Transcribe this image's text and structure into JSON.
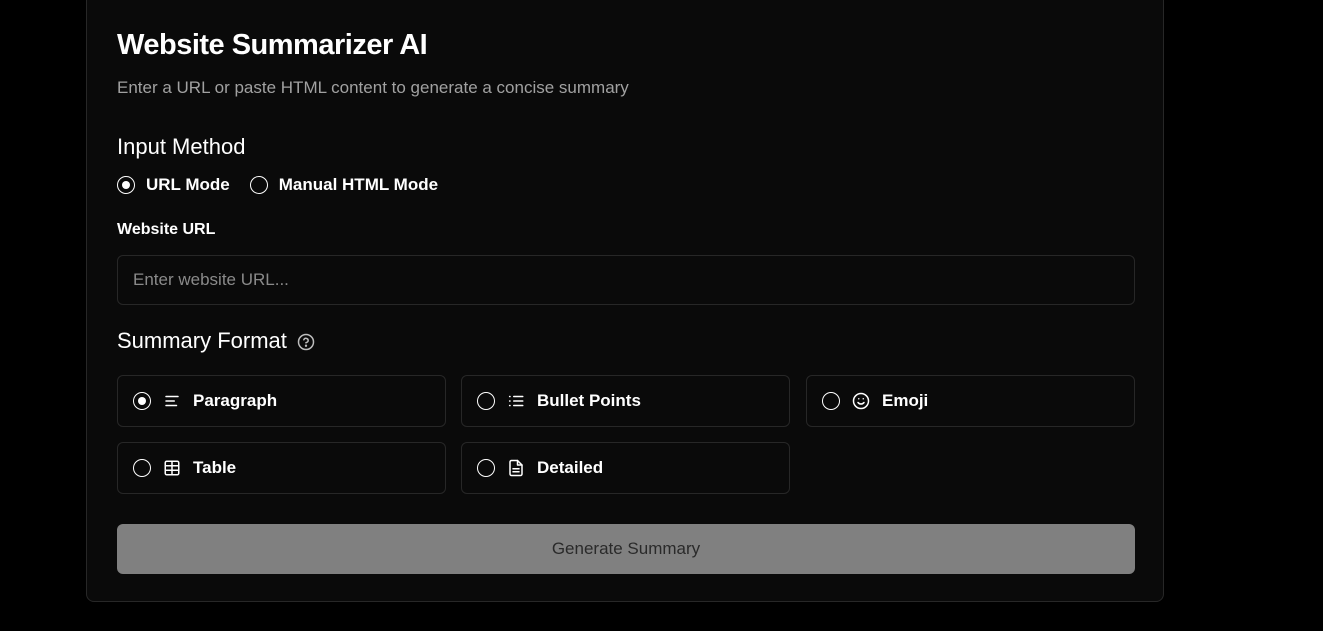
{
  "app": {
    "title": "Website Summarizer AI",
    "subtitle": "Enter a URL or paste HTML content to generate a concise summary"
  },
  "input_method": {
    "heading": "Input Method",
    "options": [
      {
        "label": "URL Mode",
        "selected": true
      },
      {
        "label": "Manual HTML Mode",
        "selected": false
      }
    ]
  },
  "url_field": {
    "label": "Website URL",
    "placeholder": "Enter website URL...",
    "value": ""
  },
  "summary_format": {
    "heading": "Summary Format",
    "help_icon": "question-circle-icon",
    "options": [
      {
        "label": "Paragraph",
        "icon": "align-left-icon",
        "selected": true
      },
      {
        "label": "Bullet Points",
        "icon": "list-icon",
        "selected": false
      },
      {
        "label": "Emoji",
        "icon": "smile-icon",
        "selected": false
      },
      {
        "label": "Table",
        "icon": "table-icon",
        "selected": false
      },
      {
        "label": "Detailed",
        "icon": "file-text-icon",
        "selected": false
      }
    ]
  },
  "actions": {
    "generate_label": "Generate Summary"
  },
  "colors": {
    "background": "#000000",
    "card": "#0a0a0a",
    "border": "#272727",
    "muted_text": "#a1a1a1",
    "button_disabled": "#808080"
  }
}
